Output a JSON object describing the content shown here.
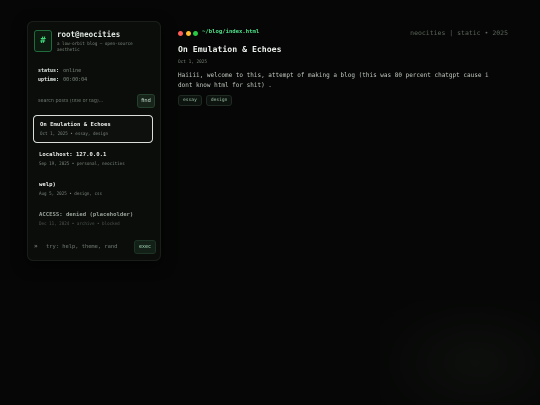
{
  "sidebar": {
    "logo_glyph": "#",
    "title": "root@neocities",
    "subtitle": "a low-orbit blog — open-source aesthetic",
    "status_label": "status:",
    "status_value": "online",
    "uptime_label": "uptime:",
    "uptime_value": "00:00:04",
    "search": {
      "placeholder": "search posts (title or tag)...",
      "value": "",
      "button_label": "find"
    },
    "posts": [
      {
        "title": "On Emulation & Echoes",
        "meta": "Oct 1, 2025 • essay, design",
        "active": true
      },
      {
        "title": "Localhost: 127.0.0.1",
        "meta": "Sep 19, 2025 • personal, neocities",
        "active": false
      },
      {
        "title": "welp)",
        "meta": "Aug 5, 2025 • design, css",
        "active": false
      },
      {
        "title": "ACCESS: denied (placeholder)",
        "meta": "Dec 11, 2024 • archive • blocked",
        "active": false
      }
    ],
    "cmd": {
      "prompt": "»",
      "placeholder": "try: help, theme, rand",
      "value": "",
      "button_label": "exec"
    }
  },
  "window_dots": {
    "red": "#ff5f57",
    "yellow": "#febc2e",
    "green": "#28c840"
  },
  "main": {
    "path": "~/blog/index.html",
    "site_meta": "neocities | static • 2025",
    "article": {
      "title": "On Emulation & Echoes",
      "date": "Oct 1, 2025",
      "body": "Haiiii, welcome to this, attempt of making a blog (this was 80 percent chatgpt cause i dont know html for shit) .",
      "tags": [
        "essay",
        "design"
      ]
    }
  },
  "colors": {
    "accent": "#4fe38b",
    "background": "#050605",
    "panel": "#0b0d0b"
  }
}
